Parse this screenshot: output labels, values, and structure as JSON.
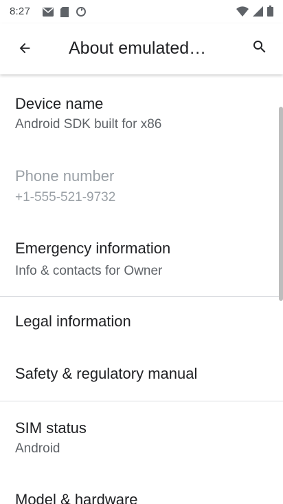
{
  "status_bar": {
    "time": "8:27",
    "left_icons": [
      "gmail-icon",
      "sd-card-icon",
      "sync-icon"
    ],
    "right_icons": [
      "wifi-icon",
      "cell-signal-icon",
      "battery-icon"
    ]
  },
  "app_bar": {
    "title": "About emulated…",
    "back_icon": "arrow-back-icon",
    "search_icon": "search-icon"
  },
  "items": [
    {
      "title": "Device name",
      "summary": "Android SDK built for x86",
      "enabled": true
    },
    {
      "title": "Phone number",
      "summary": "+1-555-521-9732",
      "enabled": false
    },
    {
      "title": "Emergency information",
      "summary": "Info & contacts for Owner",
      "enabled": true
    },
    {
      "title": "Legal information",
      "summary": "",
      "enabled": true
    },
    {
      "title": "Safety & regulatory manual",
      "summary": "",
      "enabled": true
    },
    {
      "title": "SIM status",
      "summary": "Android",
      "enabled": true
    },
    {
      "title": "Model & hardware",
      "summary": "",
      "enabled": true
    }
  ],
  "colors": {
    "primary_text": "#202124",
    "secondary_text": "#5f6368",
    "disabled_text": "#9aa0a6",
    "divider": "#dadce0"
  }
}
